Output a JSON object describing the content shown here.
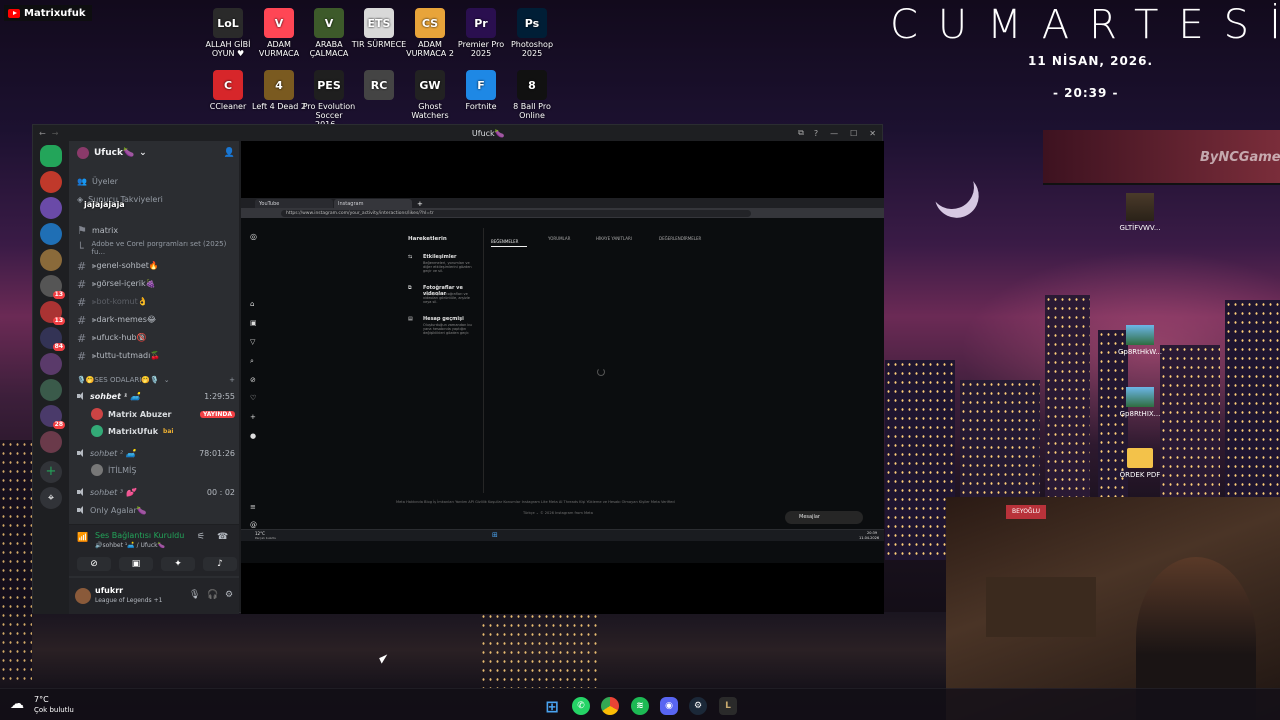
{
  "stream": {
    "channel": "Matrixufuk"
  },
  "clock": {
    "day": "CUMARTESİ",
    "date": "11 NİSAN, 2026.",
    "time": "- 20:39 -"
  },
  "watermark": "ByNCGame",
  "desktop_icons": [
    {
      "label": "ALLAH GİBİ OYUN ♥",
      "icon": "game-icon",
      "color": "#2a2a2a",
      "glyph": "LoL"
    },
    {
      "label": "ADAM VURMACA",
      "icon": "valorant-icon",
      "color": "#ff4655",
      "glyph": "V"
    },
    {
      "label": "ARABA ÇALMACA",
      "icon": "gta-icon",
      "color": "#3d5a2a",
      "glyph": "V"
    },
    {
      "label": "TIR SÜRMECE",
      "icon": "ets-icon",
      "color": "#d9d9d9",
      "glyph": "ETS"
    },
    {
      "label": "ADAM VURMACA 2",
      "icon": "cs-icon",
      "color": "#e8a43a",
      "glyph": "CS"
    },
    {
      "label": "Premier Pro 2025",
      "icon": "premiere-icon",
      "color": "#2a0f4f",
      "glyph": "Pr"
    },
    {
      "label": "Photoshop 2025",
      "icon": "photoshop-icon",
      "color": "#001e36",
      "glyph": "Ps"
    },
    {
      "label": "CCleaner",
      "icon": "ccleaner-icon",
      "color": "#d7262a",
      "glyph": "C"
    },
    {
      "label": "Left 4 Dead 2",
      "icon": "l4d2-icon",
      "color": "#7a5a20",
      "glyph": "4"
    },
    {
      "label": "Pro Evolution Soccer 2016...",
      "icon": "pes-icon",
      "color": "#1f1f1f",
      "glyph": "PES"
    },
    {
      "label": "",
      "icon": "f1-icon",
      "color": "#444",
      "glyph": "RC"
    },
    {
      "label": "Ghost Watchers",
      "icon": "ghost-icon",
      "color": "#222",
      "glyph": "GW"
    },
    {
      "label": "Fortnite",
      "icon": "fortnite-icon",
      "color": "#1e88e5",
      "glyph": "F"
    },
    {
      "label": "8 Ball Pro Online",
      "icon": "8ball-icon",
      "color": "#111",
      "glyph": "8"
    }
  ],
  "right_icons": [
    {
      "label": "GLTİFVWV...",
      "icon": "person-photo-icon"
    },
    {
      "label": "Gp8RtHkW...",
      "icon": "image-icon"
    },
    {
      "label": "Gp8RtHIX...",
      "icon": "image-icon"
    },
    {
      "label": "ÖRDEK PDF",
      "icon": "folder-icon"
    }
  ],
  "discord": {
    "window_title": "Ufuck🍆",
    "server_name": "Ufuck🍆",
    "channels_top": [
      "Üyeler",
      "Sunucu Takviyeleri"
    ],
    "overlay_text": "jajajajaja",
    "text_channels": [
      {
        "name": "matrix",
        "muted": false
      },
      {
        "name": "Adobe ve Corel porgramları set (2025) fu...",
        "muted": false,
        "sub": true
      },
      {
        "name": "⫸genel-sohbet🔥",
        "muted": false
      },
      {
        "name": "⫸görsel-içerik🍇",
        "muted": false
      },
      {
        "name": "⫸bot-komut👌",
        "muted": true
      },
      {
        "name": "⫸dark-memes😂",
        "muted": false
      },
      {
        "name": "⫸ufuck-hub🔞",
        "muted": false
      },
      {
        "name": "⫸tuttu-tutmadı🍒",
        "muted": false
      }
    ],
    "category": "🎙️🤭SES ODALARI🤭🎙️",
    "voice_channels": [
      {
        "name": "sohbet ¹ 🛋️",
        "timer": "1:29:55",
        "users": [
          {
            "name": "Matrix Abuzer",
            "tag": "YAYINDA",
            "color": "#c44"
          },
          {
            "name": "MatrixUfuk",
            "tag": "bai",
            "color": "#3a7"
          }
        ]
      },
      {
        "name": "sohbet ² 🛋️",
        "timer": "78:01:26",
        "users": [
          {
            "name": "İTİLMİŞ",
            "tag": "",
            "color": "#777"
          }
        ]
      },
      {
        "name": "sohbet ³ 💕",
        "timer": "00 : 02",
        "users": []
      },
      {
        "name": "Only Agalar🍆",
        "timer": "",
        "users": []
      }
    ],
    "voice_status": {
      "title": "Ses Bağlantısı Kuruldu",
      "sub": "🔊sohbet ¹🛋️ / Ufuck🍆"
    },
    "user": {
      "name": "ufukrr",
      "status": "League of Legends +1"
    }
  },
  "browser": {
    "tabs": [
      "YouTube",
      "Instagram"
    ],
    "url": "https://www.instagram.com/your_activity/interactions/likes/?hl=tr",
    "ig_title": "Hareketlerin",
    "ig_tabs": [
      "BEĞENMELER",
      "YORUMLAR",
      "HİKAYE YANITLARI",
      "DEĞERLENDİRMELER"
    ],
    "ig_menu": [
      {
        "title": "Etkileşimler",
        "desc": "Beğenmeleri, yorumları ve diğer etkileşimlerini gözden geçir ve sil."
      },
      {
        "title": "Fotoğraflar ve videolar",
        "desc": "Paylaştığın fotoğrafları ve videoları görüntüle, arşivle veya sil."
      },
      {
        "title": "Hesap geçmişi",
        "desc": "Oluşturduğun zamandan bu yana hesabında yaptığın değişiklikleri gözden geçir."
      }
    ],
    "footer": "Meta  Hakkında  Blog  İş İmkanları  Yardım  API  Gizlilik  Koşullar  Konumlar  Instagram Lite  Meta AI  Threads  Kişi Yükleme ve Hesabı Olmayan Kişiler  Meta Verified",
    "footer2": "Türkçe ⌄   © 2026 Instagram from Meta",
    "messages": "Mesajlar",
    "mini_weather": "12°C",
    "mini_weather_sub": "Parçalı bulutlu",
    "mini_clock": "20:39",
    "mini_date": "11.04.2026"
  },
  "taskbar": {
    "temp": "7°C",
    "weather": "Çok bulutlu"
  },
  "colors": {
    "discord_bg": "#1e1f22",
    "discord_panel": "#2b2d31",
    "accent": "#5865f2",
    "live": "#f23f43"
  }
}
